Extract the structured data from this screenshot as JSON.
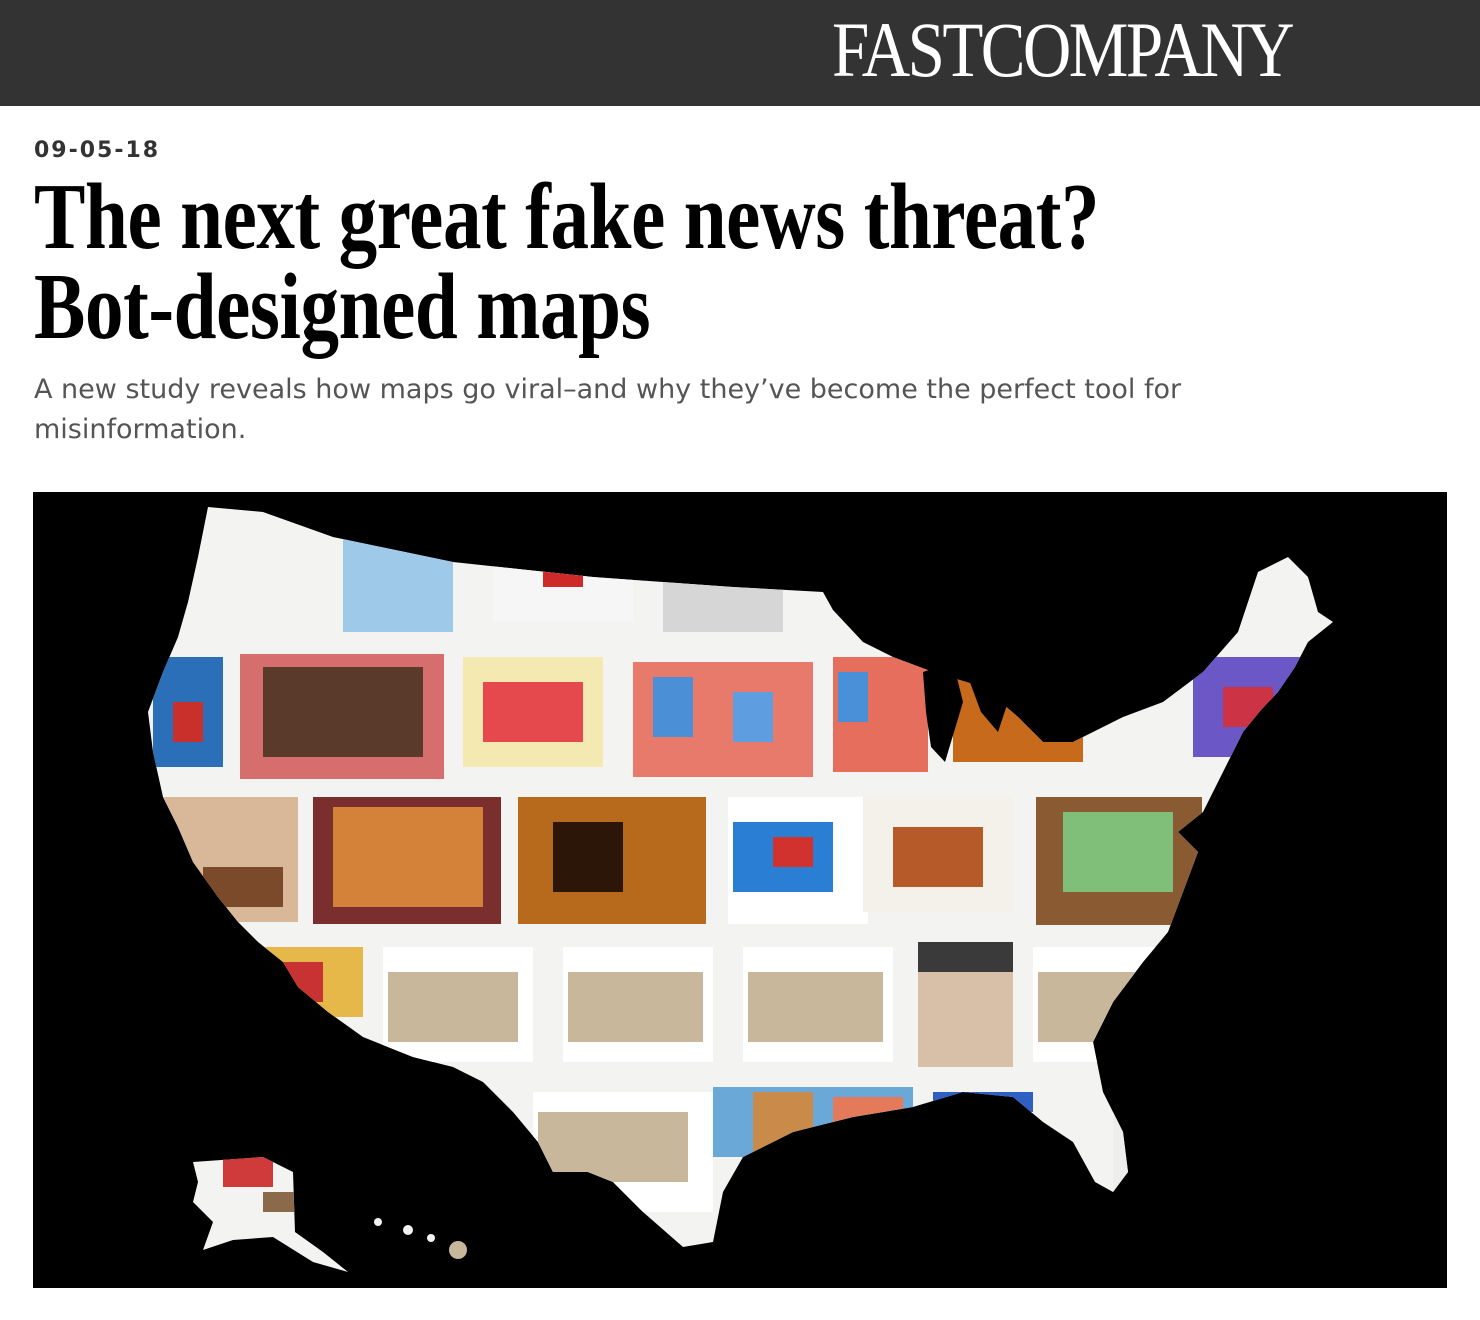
{
  "header": {
    "logo_text": "FASTCOMPANY",
    "bg_color": "#333333"
  },
  "article": {
    "date": "09-05-18",
    "headline_line1": "The next great fake news threat?",
    "headline_line2": "Bot-designed maps",
    "dek": "A new study reveals how maps go viral–and why they’ve become the perfect tool for misinformation."
  },
  "hero": {
    "description_icon": "us-map-collage-image",
    "bg_color": "#000000"
  }
}
